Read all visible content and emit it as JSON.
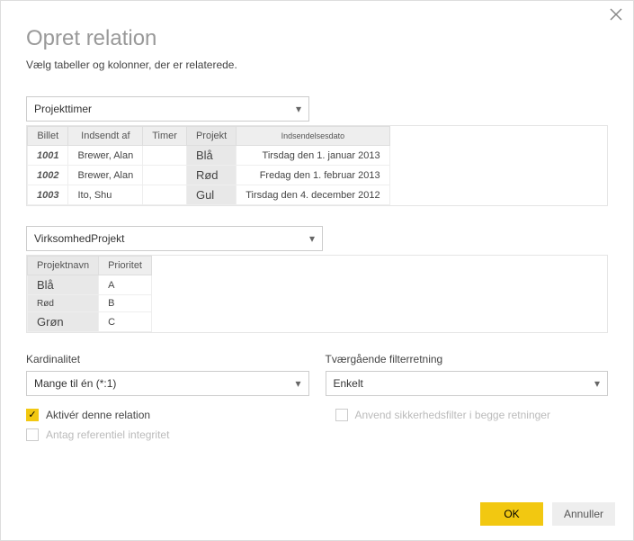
{
  "dialog": {
    "title": "Opret relation",
    "subtitle": "Vælg tabeller og kolonner, der er relaterede."
  },
  "table1": {
    "selected": "Projekttimer",
    "columns": {
      "c0": "Billet",
      "c1": "Indsendt af",
      "c2": "Timer",
      "c3": "Projekt",
      "c4": "Indsendelsesdato"
    },
    "rows": [
      {
        "c0": "1001",
        "c1": "Brewer, Alan",
        "c2": "",
        "c3": "Blå",
        "c4": "Tirsdag den 1. januar 2013"
      },
      {
        "c0": "1002",
        "c1": "Brewer, Alan",
        "c2": "",
        "c3": "Rød",
        "c4": "Fredag den 1. februar 2013"
      },
      {
        "c0": "1003",
        "c1": "Ito, Shu",
        "c2": "",
        "c3": "Gul",
        "c4": "Tirsdag den 4. december 2012"
      }
    ]
  },
  "table2": {
    "selected": "VirksomhedProjekt",
    "columns": {
      "c0": "Projektnavn",
      "c1": "Prioritet"
    },
    "rows": [
      {
        "c0": "Blå",
        "c1": "A"
      },
      {
        "c0": "Rød",
        "c1": "B"
      },
      {
        "c0": "Grøn",
        "c1": "C"
      }
    ]
  },
  "fields": {
    "cardinality_label": "Kardinalitet",
    "cardinality_value": "Mange til én (*:1)",
    "crossfilter_label": "Tværgående filterretning",
    "crossfilter_value": "Enkelt"
  },
  "checks": {
    "activate": "Aktivér denne relation",
    "referential": "Antag referentiel integritet",
    "security": "Anvend sikkerhedsfilter i begge retninger"
  },
  "buttons": {
    "ok": "OK",
    "cancel": "Annuller"
  }
}
